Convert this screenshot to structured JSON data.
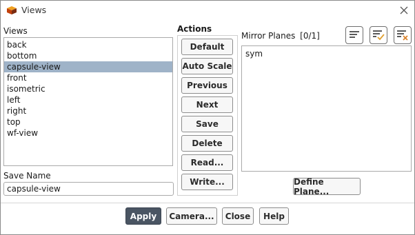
{
  "window": {
    "title": "Views",
    "close_icon": "close-icon",
    "app_icon": "fluent-app-icon"
  },
  "views_panel": {
    "label": "Views",
    "items": [
      "back",
      "bottom",
      "capsule-view",
      "front",
      "isometric",
      "left",
      "right",
      "top",
      "wf-view"
    ],
    "selected": "capsule-view"
  },
  "save_name": {
    "label": "Save Name",
    "value": "capsule-view"
  },
  "actions": {
    "label": "Actions",
    "buttons": [
      "Default",
      "Auto Scale",
      "Previous",
      "Next",
      "Save",
      "Delete",
      "Read...",
      "Write..."
    ]
  },
  "mirror_planes": {
    "label": "Mirror Planes",
    "count": "[0/1]",
    "items": [
      "sym"
    ],
    "icon_buttons": [
      "list-options-icon",
      "select-all-icon",
      "deselect-all-icon"
    ],
    "define_plane_label": "Define Plane..."
  },
  "footer": {
    "apply": "Apply",
    "camera": "Camera...",
    "close": "Close",
    "help": "Help"
  },
  "colors": {
    "selected_row": "#9fb3c8",
    "primary_button": "#4a5563",
    "accent_check": "#e0a030",
    "accent_x": "#d9822b"
  }
}
